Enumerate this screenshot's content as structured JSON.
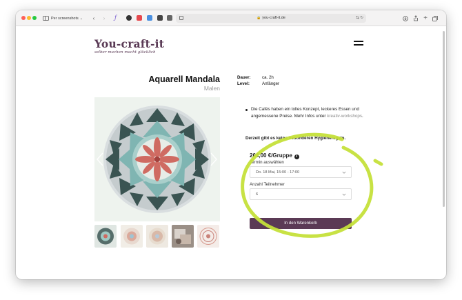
{
  "browser": {
    "tab_group_label": "Per screenshots",
    "url": "you-craft-it.de"
  },
  "site": {
    "logo_title": "You-craft-it",
    "tagline": "selber machen macht glücklich"
  },
  "product": {
    "title": "Aquarell Mandala",
    "subtitle": "Malen",
    "meta": [
      {
        "label": "Dauer:",
        "value": "ca. 2h"
      },
      {
        "label": "Level:",
        "value": "Anfänger"
      }
    ],
    "bullet": "Die Cafés haben ein tolles Konzept, leckeres Essen und angemessene Preise. Mehr Infos unter",
    "bullet_link": "kreativ-workshops",
    "bullet_end": ".",
    "hygiene_note": "Derzeit gibt es keine besonderen Hygieneregeln.",
    "price": "264,00 €/Gruppe",
    "date_label": "Termin auswählen",
    "date_value": "Do. 18 Mai, 15:00 - 17:00",
    "participants_label": "Anzahl Teilnehmer",
    "participants_value": "6",
    "cart_button": "In den Warenkorb"
  },
  "colors": {
    "brand": "#5b3a55",
    "highlight": "#c5e03a"
  }
}
